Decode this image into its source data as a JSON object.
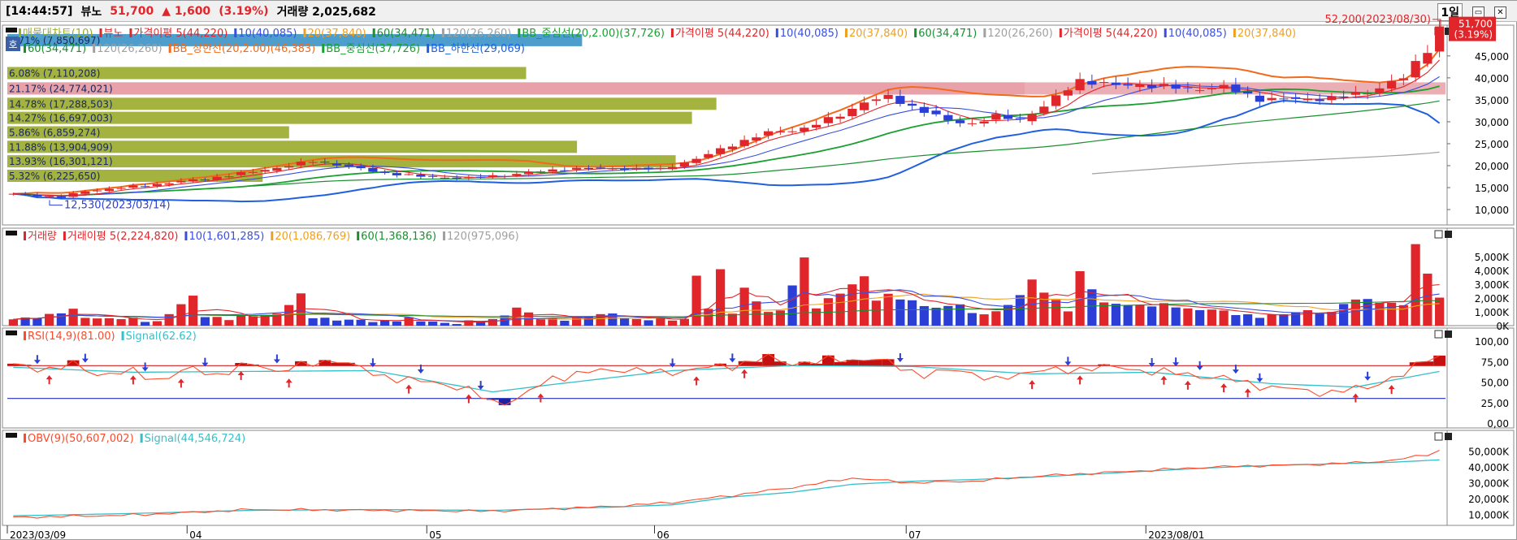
{
  "header": {
    "time": "[14:44:57]",
    "name": "뷰노",
    "price": "51,700",
    "change": "▲ 1,600",
    "pct": "(3.19%)",
    "volume_label": "거래량 2,025,682",
    "period": "1일"
  },
  "colors": {
    "up": "#e0262a",
    "down": "#2b3fd6",
    "ma5": "#e0262a",
    "ma10": "#3a4fe0",
    "ma20": "#f0a020",
    "ma60": "#1a8f30",
    "ma120": "#a0a0a0",
    "bbUpper": "#f26a1b",
    "bbMid": "#1a9f30",
    "bbLower": "#2060e0",
    "rsi": "#ff4a2a",
    "signal": "#35c0c8",
    "profile": "#9aaa2a",
    "profileTop": "#3a93c8",
    "profilePink": "#e8a0a8"
  },
  "price_panel": {
    "legend_line1": [
      {
        "t": "매물대차트(10)",
        "c": "#9aaa2a"
      },
      {
        "t": "뷰노",
        "c": "#e0262a"
      },
      {
        "t": "가격이평 5(44,220)",
        "c": "#e0262a"
      },
      {
        "t": "10(40,085)",
        "c": "#3a4fe0"
      },
      {
        "t": "20(37,840)",
        "c": "#f0a020"
      },
      {
        "t": "60(34,471)",
        "c": "#1a8f30"
      },
      {
        "t": "120(26,260)",
        "c": "#a0a0a0"
      },
      {
        "t": "BB_중심선(20,2.00)(37,726)",
        "c": "#1a9f30"
      },
      {
        "t": "가격이평 5(44,220)",
        "c": "#e0262a"
      },
      {
        "t": "10(40,085)",
        "c": "#3a4fe0"
      },
      {
        "t": "20(37,840)",
        "c": "#f0a020"
      },
      {
        "t": "60(34,471)",
        "c": "#1a8f30"
      },
      {
        "t": "120(26,260)",
        "c": "#a0a0a0"
      },
      {
        "t": "가격이평 5(44,220)",
        "c": "#e0262a"
      },
      {
        "t": "10(40,085)",
        "c": "#3a4fe0"
      },
      {
        "t": "20(37,840)",
        "c": "#f0a020"
      }
    ],
    "legend_line2": [
      {
        "t": "60(34,471)",
        "c": "#1a8f30"
      },
      {
        "t": "120(26,260)",
        "c": "#a0a0a0"
      },
      {
        "t": "BB_상한선(20,2.00)(46,383)",
        "c": "#f26a1b"
      },
      {
        "t": "BB_중심선(37,726)",
        "c": "#1a9f30"
      },
      {
        "t": "BB_하한선(29,069)",
        "c": "#2060e0"
      }
    ],
    "corner_label": "호",
    "max_label": "52,200(2023/08/30)",
    "min_label": "12,530(2023/03/14)",
    "last_price_tag": "51,700",
    "last_pct_tag": "(3.19%)",
    "y_ticks": [
      "45,000",
      "40,000",
      "35,000",
      "30,000",
      "25,000",
      "20,000",
      "15,000",
      "10,000"
    ]
  },
  "volume_profile": [
    {
      "label": "6.71% (7,850,697)",
      "price": 48500,
      "ratio": 0.565,
      "color": "#3a93c8"
    },
    {
      "label": "6.08% (7,110,208)",
      "price": 41000,
      "ratio": 0.51,
      "color": "#9aaa2a"
    },
    {
      "label": "21.17% (24,774,021)",
      "price": 37500,
      "ratio": 1.0,
      "color": "#e8a0a8"
    },
    {
      "label": "14.78% (17,288,503)",
      "price": 34000,
      "ratio": 0.697,
      "color": "#9aaa2a"
    },
    {
      "label": "14.27% (16,697,003)",
      "price": 30800,
      "ratio": 0.673,
      "color": "#9aaa2a"
    },
    {
      "label": "5.86% (6,859,274)",
      "price": 27500,
      "ratio": 0.277,
      "color": "#9aaa2a"
    },
    {
      "label": "11.88% (13,904,909)",
      "price": 24200,
      "ratio": 0.56,
      "color": "#9aaa2a"
    },
    {
      "label": "13.93% (16,301,121)",
      "price": 20900,
      "ratio": 0.657,
      "color": "#9aaa2a"
    },
    {
      "label": "5.32% (6,225,650)",
      "price": 17600,
      "ratio": 0.251,
      "color": "#9aaa2a"
    }
  ],
  "volume_panel": {
    "legend": [
      {
        "t": "거래량",
        "c": "#e0262a"
      },
      {
        "t": "거래이평 5(2,224,820)",
        "c": "#e0262a"
      },
      {
        "t": "10(1,601,285)",
        "c": "#3a4fe0"
      },
      {
        "t": "20(1,086,769)",
        "c": "#f0a020"
      },
      {
        "t": "60(1,368,136)",
        "c": "#1a8f30"
      },
      {
        "t": "120(975,096)",
        "c": "#a0a0a0"
      }
    ],
    "y_ticks": [
      "5,000K",
      "4,000K",
      "3,000K",
      "2,000K",
      "1,000K",
      "0K"
    ]
  },
  "rsi_panel": {
    "legend": [
      {
        "t": "RSI(14,9)(81.00)",
        "c": "#ff4a2a"
      },
      {
        "t": "Signal(62.62)",
        "c": "#35c0c8"
      }
    ],
    "y_ticks": [
      "100,00",
      "75,00",
      "50,00",
      "25,00",
      "0,00"
    ]
  },
  "obv_panel": {
    "legend": [
      {
        "t": "OBV(9)(50,607,002)",
        "c": "#ff4a2a"
      },
      {
        "t": "Signal(44,546,724)",
        "c": "#35c0c8"
      }
    ],
    "y_ticks": [
      "50,000K",
      "40,000K",
      "30,000K",
      "20,000K",
      "10,000K"
    ]
  },
  "x_axis": [
    {
      "label": "2023/03/09",
      "idx": 0
    },
    {
      "label": "04",
      "idx": 15
    },
    {
      "label": "05",
      "idx": 35
    },
    {
      "label": "06",
      "idx": 54
    },
    {
      "label": "07",
      "idx": 75
    },
    {
      "label": "2023/08/01",
      "idx": 95
    }
  ],
  "chart_data": {
    "type": "candlestick",
    "title": "뷰노",
    "n": 120,
    "close_keys": [
      [
        0,
        13500
      ],
      [
        4,
        12800
      ],
      [
        6,
        14200
      ],
      [
        10,
        15200
      ],
      [
        16,
        17000
      ],
      [
        20,
        18600
      ],
      [
        25,
        21000
      ],
      [
        27,
        20300
      ],
      [
        30,
        18700
      ],
      [
        34,
        17500
      ],
      [
        38,
        17200
      ],
      [
        42,
        18100
      ],
      [
        46,
        19300
      ],
      [
        50,
        19400
      ],
      [
        54,
        19200
      ],
      [
        57,
        21500
      ],
      [
        60,
        24800
      ],
      [
        63,
        27500
      ],
      [
        66,
        28500
      ],
      [
        69,
        31500
      ],
      [
        71,
        34500
      ],
      [
        73,
        35600
      ],
      [
        75,
        33500
      ],
      [
        78,
        30200
      ],
      [
        80,
        29600
      ],
      [
        82,
        31200
      ],
      [
        84,
        30500
      ],
      [
        86,
        33500
      ],
      [
        89,
        39500
      ],
      [
        92,
        38200
      ],
      [
        94,
        38500
      ],
      [
        96,
        38000
      ],
      [
        98,
        37400
      ],
      [
        101,
        37900
      ],
      [
        104,
        35200
      ],
      [
        107,
        35100
      ],
      [
        110,
        35400
      ],
      [
        113,
        36800
      ],
      [
        116,
        40000
      ],
      [
        118,
        46500
      ],
      [
        119,
        51700
      ]
    ],
    "volume_keys": [
      [
        0,
        400
      ],
      [
        3,
        800
      ],
      [
        5,
        1100
      ],
      [
        6,
        600
      ],
      [
        9,
        500
      ],
      [
        12,
        300
      ],
      [
        15,
        2100
      ],
      [
        16,
        700
      ],
      [
        18,
        500
      ],
      [
        22,
        900
      ],
      [
        24,
        2200
      ],
      [
        25,
        600
      ],
      [
        28,
        400
      ],
      [
        30,
        300
      ],
      [
        33,
        500
      ],
      [
        34,
        300
      ],
      [
        37,
        200
      ],
      [
        40,
        400
      ],
      [
        42,
        1300
      ],
      [
        44,
        500
      ],
      [
        47,
        500
      ],
      [
        50,
        900
      ],
      [
        52,
        400
      ],
      [
        56,
        500
      ],
      [
        57,
        3600
      ],
      [
        58,
        1200
      ],
      [
        59,
        4000
      ],
      [
        60,
        1000
      ],
      [
        61,
        2700
      ],
      [
        63,
        900
      ],
      [
        64,
        1100
      ],
      [
        66,
        4900
      ],
      [
        67,
        1300
      ],
      [
        69,
        2400
      ],
      [
        71,
        3600
      ],
      [
        72,
        1800
      ],
      [
        73,
        2200
      ],
      [
        75,
        1800
      ],
      [
        77,
        1200
      ],
      [
        79,
        1600
      ],
      [
        80,
        900
      ],
      [
        82,
        900
      ],
      [
        84,
        2200
      ],
      [
        85,
        3400
      ],
      [
        86,
        2400
      ],
      [
        88,
        1100
      ],
      [
        89,
        3900
      ],
      [
        91,
        1600
      ],
      [
        93,
        1500
      ],
      [
        96,
        1500
      ],
      [
        98,
        1200
      ],
      [
        100,
        1200
      ],
      [
        102,
        800
      ],
      [
        104,
        700
      ],
      [
        106,
        800
      ],
      [
        108,
        1100
      ],
      [
        110,
        900
      ],
      [
        111,
        1600
      ],
      [
        113,
        2000
      ],
      [
        114,
        1700
      ],
      [
        116,
        1500
      ],
      [
        117,
        5800
      ],
      [
        118,
        3900
      ],
      [
        119,
        2000
      ]
    ],
    "rsi_keys": [
      [
        0,
        70
      ],
      [
        3,
        66
      ],
      [
        5,
        71
      ],
      [
        7,
        60
      ],
      [
        10,
        62
      ],
      [
        12,
        53
      ],
      [
        15,
        66
      ],
      [
        17,
        59
      ],
      [
        20,
        72
      ],
      [
        22,
        64
      ],
      [
        25,
        72
      ],
      [
        27,
        78
      ],
      [
        30,
        60
      ],
      [
        33,
        52
      ],
      [
        36,
        48
      ],
      [
        38,
        40
      ],
      [
        40,
        25
      ],
      [
        42,
        29
      ],
      [
        45,
        55
      ],
      [
        48,
        62
      ],
      [
        51,
        66
      ],
      [
        54,
        61
      ],
      [
        57,
        66
      ],
      [
        60,
        70
      ],
      [
        63,
        80
      ],
      [
        64,
        75
      ],
      [
        66,
        73
      ],
      [
        69,
        78
      ],
      [
        72,
        77
      ],
      [
        74,
        69
      ],
      [
        76,
        58
      ],
      [
        79,
        66
      ],
      [
        82,
        51
      ],
      [
        85,
        65
      ],
      [
        88,
        63
      ],
      [
        90,
        69
      ],
      [
        93,
        66
      ],
      [
        96,
        62
      ],
      [
        99,
        58
      ],
      [
        102,
        52
      ],
      [
        105,
        43
      ],
      [
        108,
        40
      ],
      [
        110,
        36
      ],
      [
        113,
        45
      ],
      [
        116,
        58
      ],
      [
        118,
        81
      ],
      [
        119,
        81
      ]
    ],
    "signal_keys": [
      [
        0,
        68
      ],
      [
        10,
        62
      ],
      [
        20,
        63
      ],
      [
        30,
        64
      ],
      [
        40,
        38
      ],
      [
        45,
        47
      ],
      [
        55,
        64
      ],
      [
        65,
        70
      ],
      [
        75,
        69
      ],
      [
        85,
        60
      ],
      [
        95,
        62
      ],
      [
        105,
        48
      ],
      [
        112,
        44
      ],
      [
        119,
        63
      ]
    ],
    "obv_keys": [
      [
        0,
        8000
      ],
      [
        10,
        9500
      ],
      [
        20,
        13000
      ],
      [
        30,
        12500
      ],
      [
        40,
        12000
      ],
      [
        50,
        15000
      ],
      [
        55,
        17500
      ],
      [
        60,
        22000
      ],
      [
        65,
        27000
      ],
      [
        70,
        33000
      ],
      [
        75,
        30000
      ],
      [
        80,
        31000
      ],
      [
        85,
        34000
      ],
      [
        90,
        36000
      ],
      [
        95,
        38000
      ],
      [
        100,
        40000
      ],
      [
        105,
        41000
      ],
      [
        110,
        42000
      ],
      [
        115,
        44000
      ],
      [
        118,
        48000
      ],
      [
        119,
        50607
      ]
    ],
    "obv_signal_keys": [
      [
        0,
        9000
      ],
      [
        10,
        10500
      ],
      [
        20,
        12500
      ],
      [
        30,
        13000
      ],
      [
        40,
        12500
      ],
      [
        50,
        14500
      ],
      [
        55,
        16000
      ],
      [
        60,
        21000
      ],
      [
        65,
        24000
      ],
      [
        70,
        29000
      ],
      [
        75,
        31000
      ],
      [
        80,
        32000
      ],
      [
        85,
        33500
      ],
      [
        90,
        35500
      ],
      [
        95,
        37500
      ],
      [
        100,
        39500
      ],
      [
        105,
        41000
      ],
      [
        110,
        42000
      ],
      [
        115,
        43000
      ],
      [
        119,
        44547
      ]
    ],
    "price_ylim": [
      6500,
      52000
    ],
    "rsi_ylim": [
      0,
      100
    ],
    "rsi_lines": [
      70,
      30
    ]
  }
}
